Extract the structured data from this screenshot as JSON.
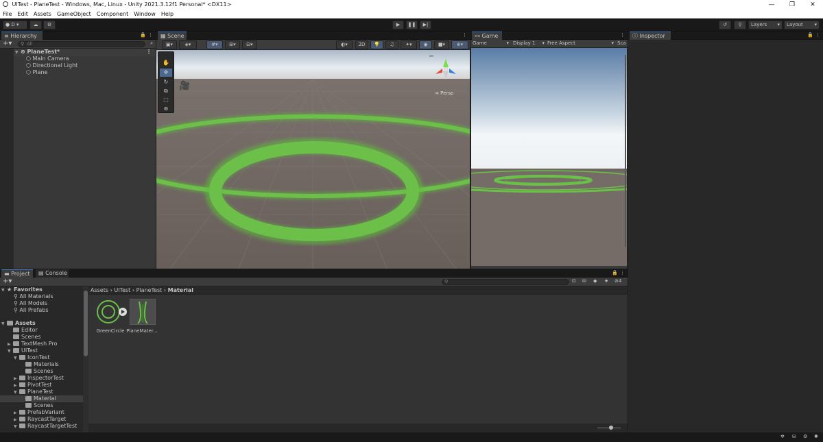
{
  "window": {
    "title": "UITest - PlaneTest - Windows, Mac, Linux - Unity 2021.3.12f1 Personal* <DX11>"
  },
  "menu": [
    "File",
    "Edit",
    "Assets",
    "GameObject",
    "Component",
    "Window",
    "Help"
  ],
  "toolbar": {
    "account_label": "D",
    "layers_label": "Layers",
    "layout_label": "Layout"
  },
  "hierarchy": {
    "tab": "Hierarchy",
    "search_placeholder": "All",
    "scene": "PlaneTest*",
    "items": [
      "Main Camera",
      "Directional Light",
      "Plane"
    ]
  },
  "scene_view": {
    "tab": "Scene",
    "btn_2d": "2D",
    "persp_label": "Persp"
  },
  "game_view": {
    "tab": "Game",
    "display": "Game",
    "display_num": "Display 1",
    "aspect": "Free Aspect",
    "scale": "Sca"
  },
  "inspector": {
    "tab": "Inspector"
  },
  "project": {
    "tab": "Project",
    "console_tab": "Console",
    "hidden_count": "4",
    "breadcrumb": [
      "Assets",
      "UITest",
      "PlaneTest",
      "Material"
    ],
    "favorites_label": "Favorites",
    "favorites": [
      "All Materials",
      "All Models",
      "All Prefabs"
    ],
    "assets_label": "Assets",
    "tree": [
      {
        "label": "Editor",
        "indent": 1,
        "arrow": ""
      },
      {
        "label": "Scenes",
        "indent": 1,
        "arrow": ""
      },
      {
        "label": "TextMesh Pro",
        "indent": 1,
        "arrow": "▶"
      },
      {
        "label": "UITest",
        "indent": 1,
        "arrow": "▼"
      },
      {
        "label": "IconTest",
        "indent": 2,
        "arrow": "▼"
      },
      {
        "label": "Materials",
        "indent": 3,
        "arrow": ""
      },
      {
        "label": "Scenes",
        "indent": 3,
        "arrow": ""
      },
      {
        "label": "InspectorTest",
        "indent": 2,
        "arrow": "▶"
      },
      {
        "label": "PivotTest",
        "indent": 2,
        "arrow": "▶"
      },
      {
        "label": "PlaneTest",
        "indent": 2,
        "arrow": "▼"
      },
      {
        "label": "Material",
        "indent": 3,
        "arrow": "",
        "selected": true
      },
      {
        "label": "Scenes",
        "indent": 3,
        "arrow": ""
      },
      {
        "label": "PrefabVariant",
        "indent": 2,
        "arrow": "▶"
      },
      {
        "label": "RaycastTarget",
        "indent": 2,
        "arrow": "▶"
      },
      {
        "label": "RaycastTargetTest",
        "indent": 2,
        "arrow": "▼"
      }
    ],
    "assets": [
      {
        "name": "GreenCircle",
        "icon": "material-ring-icon"
      },
      {
        "name": "PlaneMater...",
        "icon": "material-texture-icon"
      }
    ]
  },
  "colors": {
    "accent": "#3a79bb",
    "green": "#6cc04a",
    "ground": "#6b625d"
  }
}
